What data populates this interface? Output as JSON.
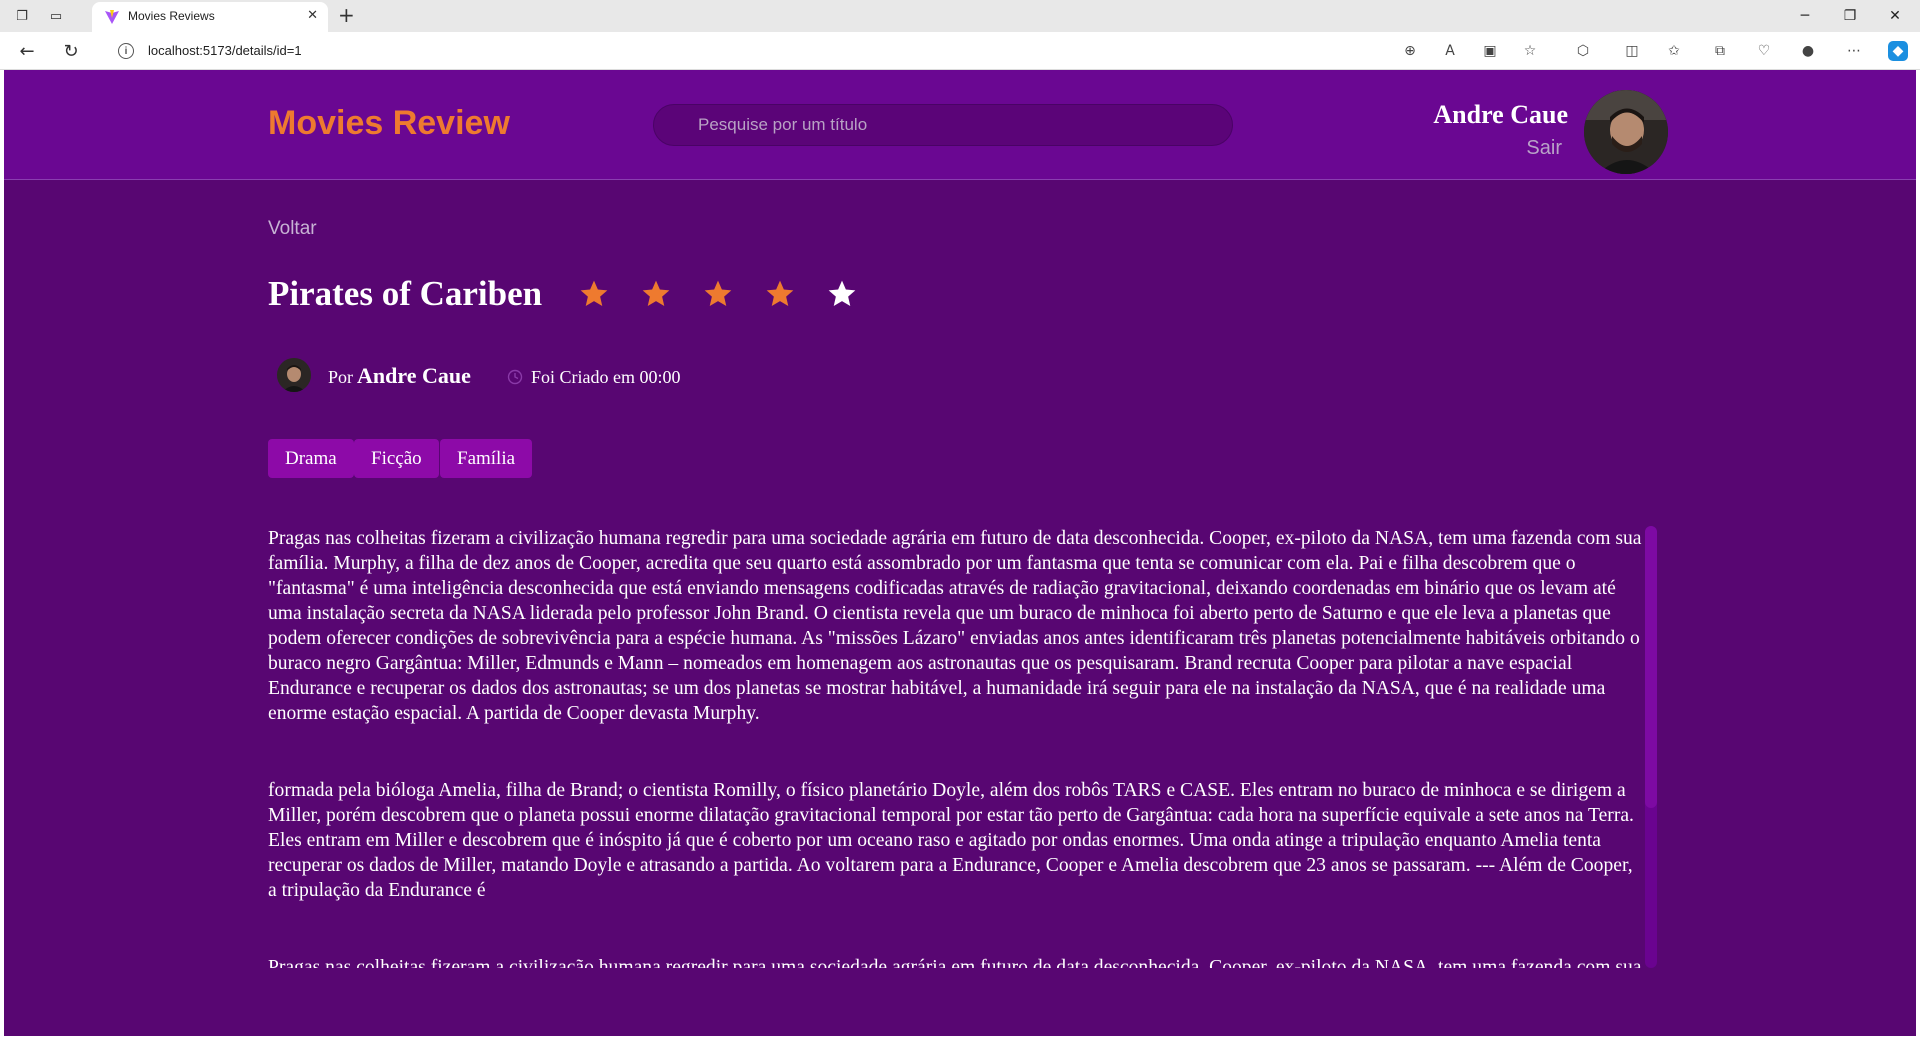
{
  "browser": {
    "tab_title": "Movies Reviews",
    "url": "localhost:5173/details/id=1"
  },
  "header": {
    "brand": "Movies Review",
    "search_placeholder": "Pesquise por um título",
    "user_name": "Andre Caue",
    "logout_label": "Sair"
  },
  "details": {
    "back_label": "Voltar",
    "title": "Pirates of Cariben",
    "rating": 4,
    "rating_max": 5,
    "by_label": "Por",
    "author": "Andre Caue",
    "created_label": "Foi Criado em 00:00",
    "tags": [
      "Drama",
      "Ficção",
      "Família"
    ],
    "paragraphs": [
      "Pragas nas colheitas fizeram a civilização humana regredir para uma sociedade agrária em futuro de data desconhecida. Cooper, ex-piloto da NASA, tem uma fazenda com sua família. Murphy, a filha de dez anos de Cooper, acredita que seu quarto está assombrado por um fantasma que tenta se comunicar com ela. Pai e filha descobrem que o \"fantasma\" é uma inteligência desconhecida que está enviando mensagens codificadas através de radiação gravitacional, deixando coordenadas em binário que os levam até uma instalação secreta da NASA liderada pelo professor John Brand. O cientista revela que um buraco de minhoca foi aberto perto de Saturno e que ele leva a planetas que podem oferecer condições de sobrevivência para a espécie humana. As \"missões Lázaro\" enviadas anos antes identificaram três planetas potencialmente habitáveis orbitando o buraco negro Gargântua: Miller, Edmunds e Mann – nomeados em homenagem aos astronautas que os pesquisaram. Brand recruta Cooper para pilotar a nave espacial Endurance e recuperar os dados dos astronautas; se um dos planetas se mostrar habitável, a humanidade irá seguir para ele na instalação da NASA, que é na realidade uma enorme estação espacial. A partida de Cooper devasta Murphy.",
      "formada pela bióloga Amelia, filha de Brand; o cientista Romilly, o físico planetário Doyle, além dos robôs TARS e CASE. Eles entram no buraco de minhoca e se dirigem a Miller, porém descobrem que o planeta possui enorme dilatação gravitacional temporal por estar tão perto de Gargântua: cada hora na superfície equivale a sete anos na Terra. Eles entram em Miller e descobrem que é inóspito já que é coberto por um oceano raso e agitado por ondas enormes. Uma onda atinge a tripulação enquanto Amelia tenta recuperar os dados de Miller, matando Doyle e atrasando a partida. Ao voltarem para a Endurance, Cooper e Amelia descobrem que 23 anos se passaram. --- Além de Cooper, a tripulação da Endurance é",
      "Pragas nas colheitas fizeram a civilização humana regredir para uma sociedade agrária em futuro de data desconhecida. Cooper, ex-piloto da NASA, tem uma fazenda com sua família."
    ]
  },
  "colors": {
    "page_bg": "#580672",
    "header_bg": "#6a0792",
    "accent": "#ee7a2f",
    "tag_bg": "#8d0aa8",
    "star_filled": "#ee7a2f",
    "star_empty": "#ffffff"
  }
}
